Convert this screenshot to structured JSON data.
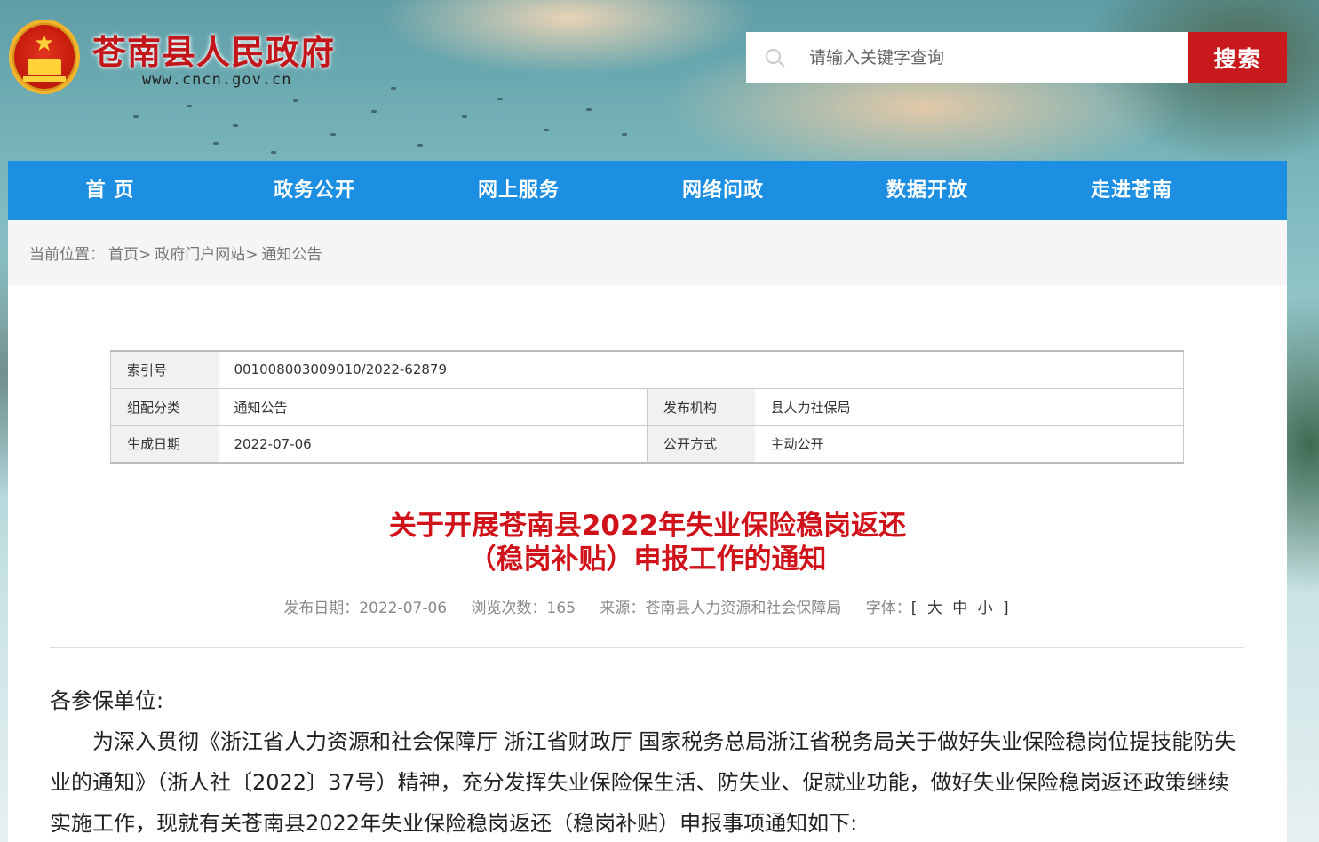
{
  "header": {
    "site_title": "苍南县人民政府",
    "site_url": "www.cncn.gov.cn",
    "search_placeholder": "请输入关键字查询",
    "search_button": "搜索"
  },
  "nav": {
    "items": [
      "首 页",
      "政务公开",
      "网上服务",
      "网络问政",
      "数据开放",
      "走进苍南"
    ]
  },
  "breadcrumb": {
    "prefix": "当前位置：",
    "items": [
      "首页>",
      "政府门户网站>",
      "通知公告"
    ]
  },
  "meta": {
    "index_label": "索引号",
    "index_value": "001008003009010/2022-62879",
    "category_label": "组配分类",
    "category_value": "通知公告",
    "org_label": "发布机构",
    "org_value": "县人力社保局",
    "date_label": "生成日期",
    "date_value": "2022-07-06",
    "mode_label": "公开方式",
    "mode_value": "主动公开"
  },
  "article": {
    "title_line1": "关于开展苍南县2022年失业保险稳岗返还",
    "title_line2": "（稳岗补贴）申报工作的通知",
    "publish_date": "发布日期：2022-07-06",
    "views": "浏览次数：165",
    "source": "来源：苍南县人力资源和社会保障局",
    "font_label": "字体：",
    "font_sizes": "[ 大 中 小 ]",
    "salutation": "各参保单位:",
    "paragraph1": "为深入贯彻《浙江省人力资源和社会保障厅 浙江省财政厅 国家税务总局浙江省税务局关于做好失业保险稳岗位提技能防失业的通知》（浙人社〔2022〕37号）精神，充分发挥失业保险保生活、防失业、促就业功能，做好失业保险稳岗返还政策继续实施工作，现就有关苍南县2022年失业保险稳岗返还（稳岗补贴）申报事项通知如下:"
  },
  "colors": {
    "nav_blue": "#1d8fe2",
    "title_red": "#d0131b",
    "search_red": "#c8191c"
  }
}
